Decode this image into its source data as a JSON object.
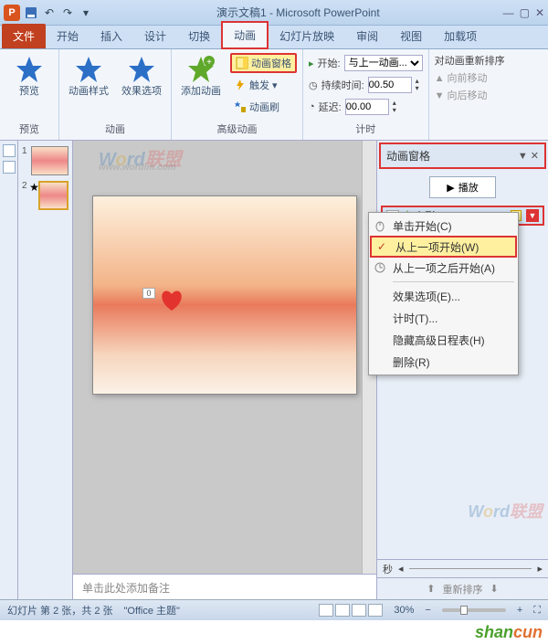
{
  "title": "演示文稿1 - Microsoft PowerPoint",
  "tabs": {
    "file": "文件",
    "home": "开始",
    "insert": "插入",
    "design": "设计",
    "transitions": "切换",
    "animations": "动画",
    "slideshow": "幻灯片放映",
    "review": "审阅",
    "view": "视图",
    "addins": "加载项"
  },
  "ribbon": {
    "preview": "预览",
    "preview_group": "预览",
    "anim_styles": "动画样式",
    "effect_options": "效果选项",
    "anim_group": "动画",
    "add_anim": "添加动画",
    "anim_pane": "动画窗格",
    "trigger": "触发",
    "anim_painter": "动画刷",
    "advanced_group": "高级动画",
    "start_label": "开始:",
    "start_value": "与上一动画...",
    "duration_label": "持续时间:",
    "duration_value": "00.50",
    "delay_label": "延迟:",
    "delay_value": "00.00",
    "timing_group": "计时",
    "reorder_title": "对动画重新排序",
    "move_earlier": "向前移动",
    "move_later": "向后移动"
  },
  "pane": {
    "title": "动画窗格",
    "play": "播放",
    "item_index": "0",
    "item_name": "心形 1",
    "seconds_label": "秒",
    "reorder_label": "重新排序"
  },
  "ctx": {
    "on_click": "单击开始(C)",
    "with_prev": "从上一项开始(W)",
    "after_prev": "从上一项之后开始(A)",
    "effect": "效果选项(E)...",
    "timing": "计时(T)...",
    "hide_timeline": "隐藏高级日程表(H)",
    "remove": "删除(R)"
  },
  "thumbs": {
    "t1": "1",
    "t2": "2"
  },
  "notes_placeholder": "单击此处添加备注",
  "status": {
    "slide": "幻灯片 第 2 张，共 2 张",
    "theme": "\"Office 主题\"",
    "zoom": "30%"
  },
  "watermark": "Word联盟",
  "watermark_url": "www.wordlm.com",
  "shancun": "shancun"
}
